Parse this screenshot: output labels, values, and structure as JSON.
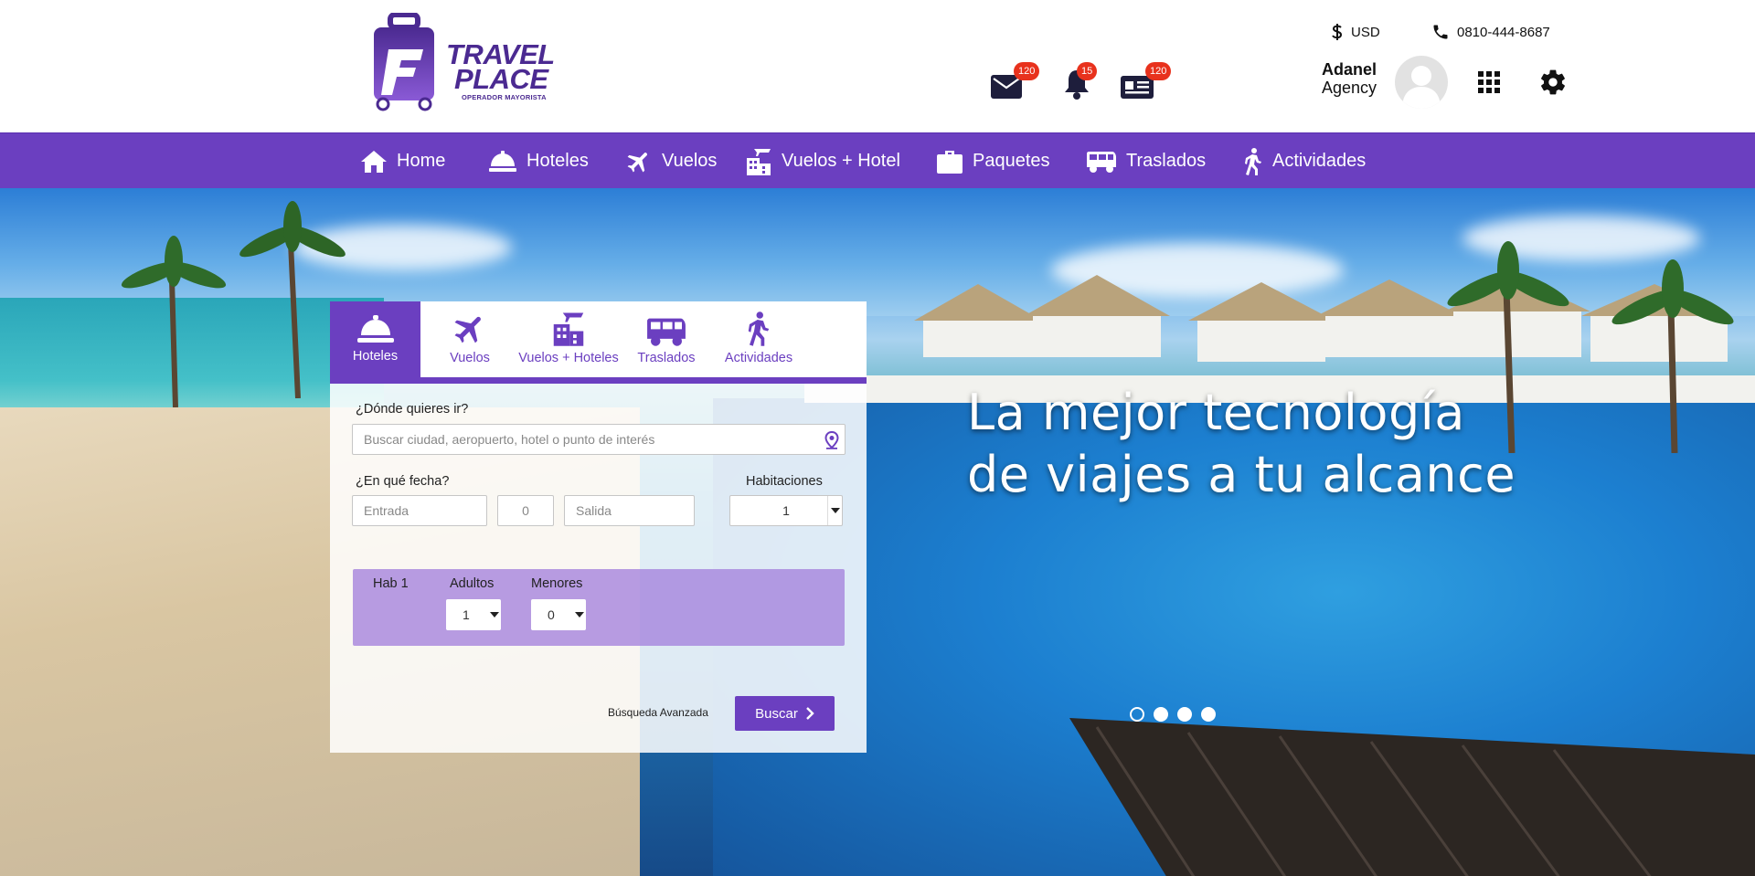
{
  "brand": {
    "name_line1": "TRAVEL",
    "name_line2": "PLACE",
    "tagline": "OPERADOR MAYORISTA",
    "color": "#4b2a91"
  },
  "topbar": {
    "currency": "USD",
    "currency_icon": "dollar-icon",
    "phone": "0810-444-8687",
    "phone_icon": "phone-icon"
  },
  "notifications": {
    "messages": "120",
    "alerts": "15",
    "vouchers": "120"
  },
  "user": {
    "name": "Adanel",
    "role": "Agency"
  },
  "nav": {
    "items": [
      {
        "label": "Home",
        "icon": "home-icon"
      },
      {
        "label": "Hoteles",
        "icon": "bell-service-icon"
      },
      {
        "label": "Vuelos",
        "icon": "plane-icon"
      },
      {
        "label": "Vuelos + Hotel",
        "icon": "plane-building-icon"
      },
      {
        "label": "Paquetes",
        "icon": "suitcase-icon"
      },
      {
        "label": "Traslados",
        "icon": "van-icon"
      },
      {
        "label": "Actividades",
        "icon": "walking-icon"
      }
    ],
    "color": "#6b3fc0"
  },
  "hero": {
    "headline": "La mejor tecnología de viajes a tu alcance",
    "slides": 4,
    "active_slide": 1
  },
  "search": {
    "tabs": [
      {
        "label": "Hoteles",
        "active": true
      },
      {
        "label": "Vuelos"
      },
      {
        "label": "Vuelos + Hoteles"
      },
      {
        "label": "Traslados"
      },
      {
        "label": "Actividades"
      }
    ],
    "destination_label": "¿Dónde quieres ir?",
    "destination_placeholder": "Buscar ciudad, aeropuerto, hotel o punto de interés",
    "date_label": "¿En qué fecha?",
    "checkin_placeholder": "Entrada",
    "nights": "0",
    "checkout_placeholder": "Salida",
    "rooms_label": "Habitaciones",
    "rooms_value": "1",
    "room": {
      "name": "Hab 1",
      "adults_label": "Adultos",
      "adults_value": "1",
      "minors_label": "Menores",
      "minors_value": "0"
    },
    "advanced_label": "Búsqueda Avanzada",
    "submit_label": "Buscar"
  }
}
